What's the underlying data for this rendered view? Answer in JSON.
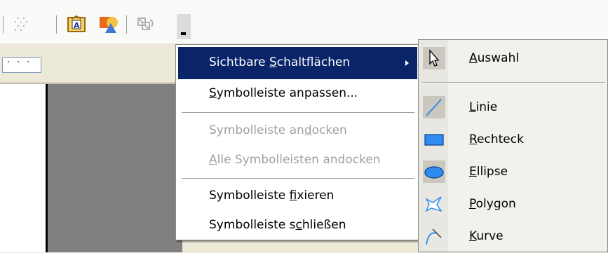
{
  "toolbar": {
    "icons": [
      "points-icon",
      "fontwork-gallery-icon",
      "shapes-icon",
      "extrusion-icon",
      "toolbar-options-chevron-icon"
    ]
  },
  "menu": {
    "items": [
      {
        "pre": "Sichtbare ",
        "key": "S",
        "post": "chaltflächen",
        "state": "selected",
        "has_submenu": true
      },
      {
        "pre": "",
        "key": "S",
        "post": "ymbolleiste anpassen...",
        "state": "enabled"
      },
      {
        "pre": "Symbolleiste an",
        "key": "d",
        "post": "ocken",
        "state": "disabled"
      },
      {
        "pre": "",
        "key": "A",
        "post": "lle Symbolleisten andocken",
        "state": "disabled"
      },
      {
        "pre": "Symbolleiste ",
        "key": "f",
        "post": "ixieren",
        "state": "enabled"
      },
      {
        "pre": "Symbolleiste s",
        "key": "c",
        "post": "hließen",
        "state": "enabled"
      }
    ]
  },
  "submenu": {
    "items": [
      {
        "pre": "",
        "key": "A",
        "post": "uswahl",
        "icon": "cursor-arrow-icon",
        "checked": true
      },
      {
        "pre": "",
        "key": "L",
        "post": "inie",
        "icon": "line-icon",
        "checked": true
      },
      {
        "pre": "",
        "key": "R",
        "post": "echteck",
        "icon": "rectangle-icon",
        "checked": false
      },
      {
        "pre": "",
        "key": "E",
        "post": "llipse",
        "icon": "ellipse-icon",
        "checked": true
      },
      {
        "pre": "",
        "key": "P",
        "post": "olygon",
        "icon": "polygon-icon",
        "checked": false
      },
      {
        "pre": "",
        "key": "K",
        "post": "urve",
        "icon": "curve-icon",
        "checked": false
      }
    ]
  },
  "colors": {
    "selection": "#0a246a",
    "shape_fill": "#2e8cf0",
    "disabled_text": "#a0a0a0"
  }
}
